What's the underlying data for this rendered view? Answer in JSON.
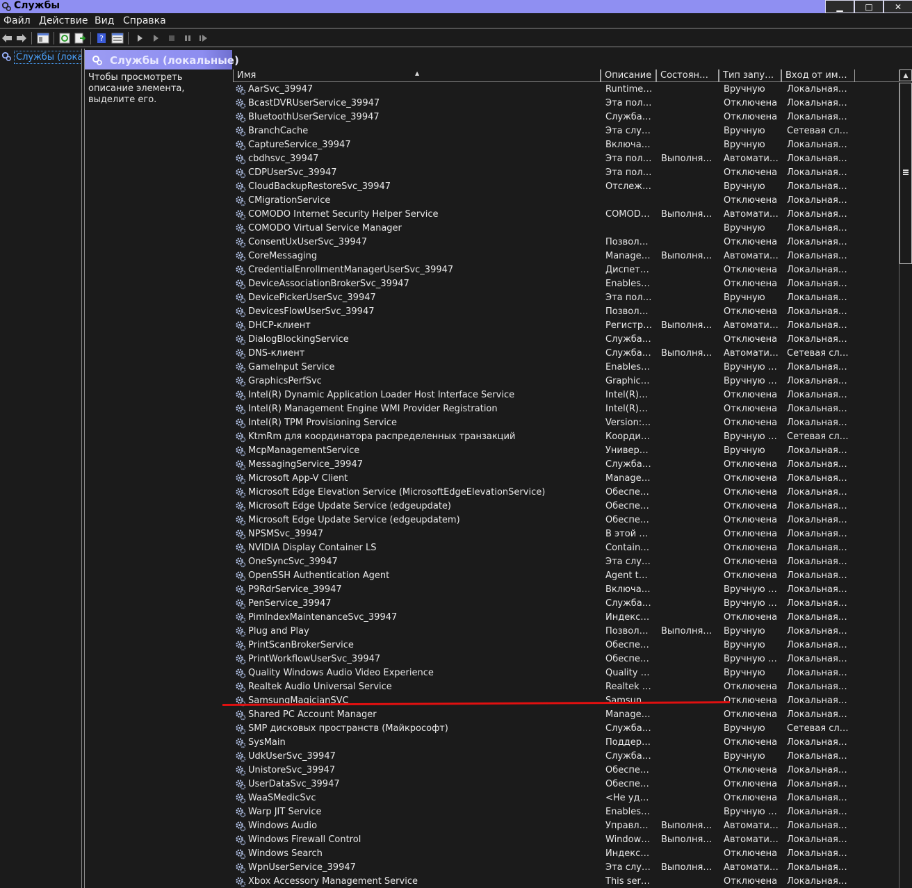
{
  "window": {
    "title": "Службы"
  },
  "window_controls": {
    "minimize": "▁",
    "maximize": "□",
    "close": "✕"
  },
  "menu": [
    "Файл",
    "Действие",
    "Вид",
    "Справка"
  ],
  "tree": {
    "item_label": "Службы (лока"
  },
  "main": {
    "title": "Службы (локальные)",
    "description_hint": "Чтобы просмотреть описание элемента, выделите его."
  },
  "columns": {
    "name": "Имя",
    "description": "Описание",
    "state": "Состоян…",
    "startup_type": "Тип запу…",
    "logon_as": "Вход от им…"
  },
  "colors": {
    "title_bar": "#8f8ff2",
    "selection_text": "#4aa3ff",
    "annotation_line": "#e01010"
  },
  "services": [
    {
      "name": "AarSvc_39947",
      "desc": "Runtime…",
      "state": "",
      "type": "Вручную",
      "logon": "Локальная…"
    },
    {
      "name": "BcastDVRUserService_39947",
      "desc": "Эта пол…",
      "state": "",
      "type": "Отключена",
      "logon": "Локальная…"
    },
    {
      "name": "BluetoothUserService_39947",
      "desc": "Служба…",
      "state": "",
      "type": "Отключена",
      "logon": "Локальная…"
    },
    {
      "name": "BranchCache",
      "desc": "Эта слу…",
      "state": "",
      "type": "Вручную",
      "logon": "Сетевая сл…"
    },
    {
      "name": "CaptureService_39947",
      "desc": "Включа…",
      "state": "",
      "type": "Вручную",
      "logon": "Локальная…"
    },
    {
      "name": "cbdhsvc_39947",
      "desc": "Эта пол…",
      "state": "Выполня…",
      "type": "Автомати…",
      "logon": "Локальная…"
    },
    {
      "name": "CDPUserSvc_39947",
      "desc": "Эта пол…",
      "state": "",
      "type": "Отключена",
      "logon": "Локальная…"
    },
    {
      "name": "CloudBackupRestoreSvc_39947",
      "desc": "Отслеж…",
      "state": "",
      "type": "Вручную",
      "logon": "Локальная…"
    },
    {
      "name": "CMigrationService",
      "desc": "",
      "state": "",
      "type": "Отключена",
      "logon": "Локальная…"
    },
    {
      "name": "COMODO Internet Security Helper Service",
      "desc": "COMOD…",
      "state": "Выполня…",
      "type": "Автомати…",
      "logon": "Локальная…"
    },
    {
      "name": "COMODO Virtual Service Manager",
      "desc": "",
      "state": "",
      "type": "Вручную",
      "logon": "Локальная…"
    },
    {
      "name": "ConsentUxUserSvc_39947",
      "desc": "Позвол…",
      "state": "",
      "type": "Отключена",
      "logon": "Локальная…"
    },
    {
      "name": "CoreMessaging",
      "desc": "Manage…",
      "state": "Выполня…",
      "type": "Автомати…",
      "logon": "Локальная…"
    },
    {
      "name": "CredentialEnrollmentManagerUserSvc_39947",
      "desc": "Диспет…",
      "state": "",
      "type": "Отключена",
      "logon": "Локальная…"
    },
    {
      "name": "DeviceAssociationBrokerSvc_39947",
      "desc": "Enables…",
      "state": "",
      "type": "Отключена",
      "logon": "Локальная…"
    },
    {
      "name": "DevicePickerUserSvc_39947",
      "desc": "Эта пол…",
      "state": "",
      "type": "Вручную",
      "logon": "Локальная…"
    },
    {
      "name": "DevicesFlowUserSvc_39947",
      "desc": "Позвол…",
      "state": "",
      "type": "Отключена",
      "logon": "Локальная…"
    },
    {
      "name": "DHCP-клиент",
      "desc": "Регистр…",
      "state": "Выполня…",
      "type": "Автомати…",
      "logon": "Локальная…"
    },
    {
      "name": "DialogBlockingService",
      "desc": "Служба…",
      "state": "",
      "type": "Отключена",
      "logon": "Локальная…"
    },
    {
      "name": "DNS-клиент",
      "desc": "Служба…",
      "state": "Выполня…",
      "type": "Автомати…",
      "logon": "Сетевая сл…"
    },
    {
      "name": "GameInput Service",
      "desc": "Enables…",
      "state": "",
      "type": "Вручную …",
      "logon": "Локальная…"
    },
    {
      "name": "GraphicsPerfSvc",
      "desc": "Graphic…",
      "state": "",
      "type": "Вручную …",
      "logon": "Локальная…"
    },
    {
      "name": "Intel(R) Dynamic Application Loader Host Interface Service",
      "desc": "Intel(R)…",
      "state": "",
      "type": "Отключена",
      "logon": "Локальная…"
    },
    {
      "name": "Intel(R) Management Engine WMI Provider Registration",
      "desc": "Intel(R)…",
      "state": "",
      "type": "Отключена",
      "logon": "Локальная…"
    },
    {
      "name": "Intel(R) TPM Provisioning Service",
      "desc": "Version:…",
      "state": "",
      "type": "Отключена",
      "logon": "Локальная…"
    },
    {
      "name": "KtmRm для координатора распределенных транзакций",
      "desc": "Коорди…",
      "state": "",
      "type": "Вручную …",
      "logon": "Сетевая сл…"
    },
    {
      "name": "McpManagementService",
      "desc": "Универ…",
      "state": "",
      "type": "Вручную",
      "logon": "Локальная…"
    },
    {
      "name": "MessagingService_39947",
      "desc": "Служба…",
      "state": "",
      "type": "Отключена",
      "logon": "Локальная…"
    },
    {
      "name": "Microsoft App-V Client",
      "desc": "Manage…",
      "state": "",
      "type": "Отключена",
      "logon": "Локальная…"
    },
    {
      "name": "Microsoft Edge Elevation Service (MicrosoftEdgeElevationService)",
      "desc": "Обеспе…",
      "state": "",
      "type": "Отключена",
      "logon": "Локальная…"
    },
    {
      "name": "Microsoft Edge Update Service (edgeupdate)",
      "desc": "Обеспе…",
      "state": "",
      "type": "Отключена",
      "logon": "Локальная…"
    },
    {
      "name": "Microsoft Edge Update Service (edgeupdatem)",
      "desc": "Обеспе…",
      "state": "",
      "type": "Отключена",
      "logon": "Локальная…"
    },
    {
      "name": "NPSMSvc_39947",
      "desc": "В этой …",
      "state": "",
      "type": "Отключена",
      "logon": "Локальная…"
    },
    {
      "name": "NVIDIA Display Container LS",
      "desc": "Contain…",
      "state": "",
      "type": "Отключена",
      "logon": "Локальная…"
    },
    {
      "name": "OneSyncSvc_39947",
      "desc": "Эта слу…",
      "state": "",
      "type": "Отключена",
      "logon": "Локальная…"
    },
    {
      "name": "OpenSSH Authentication Agent",
      "desc": "Agent t…",
      "state": "",
      "type": "Отключена",
      "logon": "Локальная…"
    },
    {
      "name": "P9RdrService_39947",
      "desc": "Включа…",
      "state": "",
      "type": "Вручную …",
      "logon": "Локальная…"
    },
    {
      "name": "PenService_39947",
      "desc": "Служба…",
      "state": "",
      "type": "Вручную …",
      "logon": "Локальная…"
    },
    {
      "name": "PimIndexMaintenanceSvc_39947",
      "desc": "Индекс…",
      "state": "",
      "type": "Отключена",
      "logon": "Локальная…"
    },
    {
      "name": "Plug and Play",
      "desc": "Позвол…",
      "state": "Выполня…",
      "type": "Вручную",
      "logon": "Локальная…"
    },
    {
      "name": "PrintScanBrokerService",
      "desc": "Обеспе…",
      "state": "",
      "type": "Вручную",
      "logon": "Локальная…"
    },
    {
      "name": "PrintWorkflowUserSvc_39947",
      "desc": "Обеспе…",
      "state": "",
      "type": "Вручную …",
      "logon": "Локальная…"
    },
    {
      "name": "Quality Windows Audio Video Experience",
      "desc": "Quality …",
      "state": "",
      "type": "Вручную",
      "logon": "Локальная…"
    },
    {
      "name": "Realtek Audio Universal Service",
      "desc": "Realtek …",
      "state": "",
      "type": "Отключена",
      "logon": "Локальная…"
    },
    {
      "name": "SamsungMagicianSVC",
      "desc": "Samsun…",
      "state": "",
      "type": "Отключена",
      "logon": "Локальная…"
    },
    {
      "name": "Shared PC Account Manager",
      "desc": "Manage…",
      "state": "",
      "type": "Отключена",
      "logon": "Локальная…"
    },
    {
      "name": "SMP дисковых пространств (Майкрософт)",
      "desc": "Служба…",
      "state": "",
      "type": "Вручную",
      "logon": "Сетевая сл…"
    },
    {
      "name": "SysMain",
      "desc": "Поддер…",
      "state": "",
      "type": "Отключена",
      "logon": "Локальная…"
    },
    {
      "name": "UdkUserSvc_39947",
      "desc": "Служба…",
      "state": "",
      "type": "Вручную",
      "logon": "Локальная…"
    },
    {
      "name": "UnistoreSvc_39947",
      "desc": "Обеспе…",
      "state": "",
      "type": "Отключена",
      "logon": "Локальная…"
    },
    {
      "name": "UserDataSvc_39947",
      "desc": "Обеспе…",
      "state": "",
      "type": "Отключена",
      "logon": "Локальная…"
    },
    {
      "name": "WaaSMedicSvc",
      "desc": "<Не уд…",
      "state": "",
      "type": "Отключена",
      "logon": "Локальная…"
    },
    {
      "name": "Warp JIT Service",
      "desc": "Enables…",
      "state": "",
      "type": "Вручную …",
      "logon": "Локальная…"
    },
    {
      "name": "Windows Audio",
      "desc": "Управл…",
      "state": "Выполня…",
      "type": "Автомати…",
      "logon": "Локальная…"
    },
    {
      "name": "Windows Firewall Control",
      "desc": "Window…",
      "state": "Выполня…",
      "type": "Автомати…",
      "logon": "Локальная…"
    },
    {
      "name": "Windows Search",
      "desc": "Индекс…",
      "state": "",
      "type": "Отключена",
      "logon": "Локальная…"
    },
    {
      "name": "WpnUserService_39947",
      "desc": "Эта слу…",
      "state": "Выполня…",
      "type": "Автомати…",
      "logon": "Локальная…"
    },
    {
      "name": "Xbox Accessory Management Service",
      "desc": "This ser…",
      "state": "",
      "type": "Отключена",
      "logon": "Локальная…"
    }
  ]
}
